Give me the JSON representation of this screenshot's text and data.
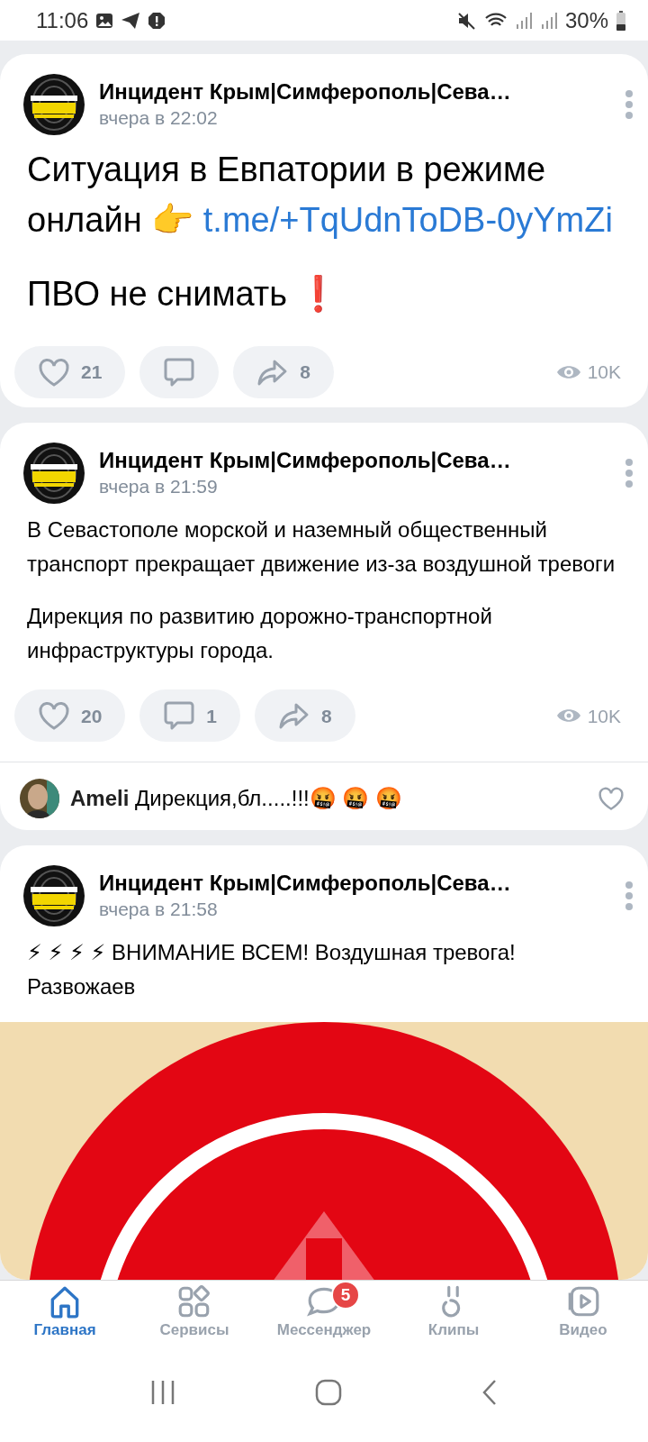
{
  "status_bar": {
    "time": "11:06",
    "battery": "30%"
  },
  "posts": [
    {
      "kind": "large",
      "author": "Инцидент Крым|Симферополь|Сева…",
      "time": "вчера в 22:02",
      "paragraphs": [
        [
          {
            "text": "Ситуация в Евпатории в режиме онлайн 👉 "
          },
          {
            "link": "t.me/+TqUdnToDB-0yYmZi"
          }
        ],
        [
          {
            "text": "ПВО не снимать ❗"
          }
        ]
      ],
      "actions": {
        "likes": "21",
        "shares": "8",
        "views": "10K"
      }
    },
    {
      "kind": "normal",
      "author": "Инцидент Крым|Симферополь|Сева…",
      "time": "вчера в 21:59",
      "paragraphs": [
        [
          {
            "text": "В Севастополе морской и наземный общественный транспорт прекращает движение из-за воздушной тревоги"
          }
        ],
        [
          {
            "text": "Дирекция по развитию дорожно-транспортной инфраструктуры города."
          }
        ]
      ],
      "actions": {
        "likes": "20",
        "comments": "1",
        "shares": "8",
        "views": "10K"
      },
      "comment": {
        "author": "Ameli",
        "text": "Дирекция,бл.....!!!🤬 🤬 🤬",
        "liked": false
      }
    },
    {
      "kind": "normal",
      "author": "Инцидент Крым|Симферополь|Сева…",
      "time": "вчера в 21:58",
      "paragraphs": [
        [
          {
            "text": "⚡ ⚡ ⚡ ⚡ ВНИМАНИЕ ВСЕМ! Воздушная тревога! Развожаев"
          }
        ]
      ],
      "attachment": {
        "kind": "picture"
      }
    }
  ],
  "bottom_nav": [
    {
      "label": "Главная",
      "kind": "home",
      "selected": true
    },
    {
      "label": "Сервисы",
      "kind": "services",
      "selected": false
    },
    {
      "label": "Мессенджер",
      "kind": "messenger",
      "selected": false,
      "badge": "5"
    },
    {
      "label": "Клипы",
      "kind": "clips",
      "selected": false
    },
    {
      "label": "Видео",
      "kind": "video",
      "selected": false
    }
  ]
}
